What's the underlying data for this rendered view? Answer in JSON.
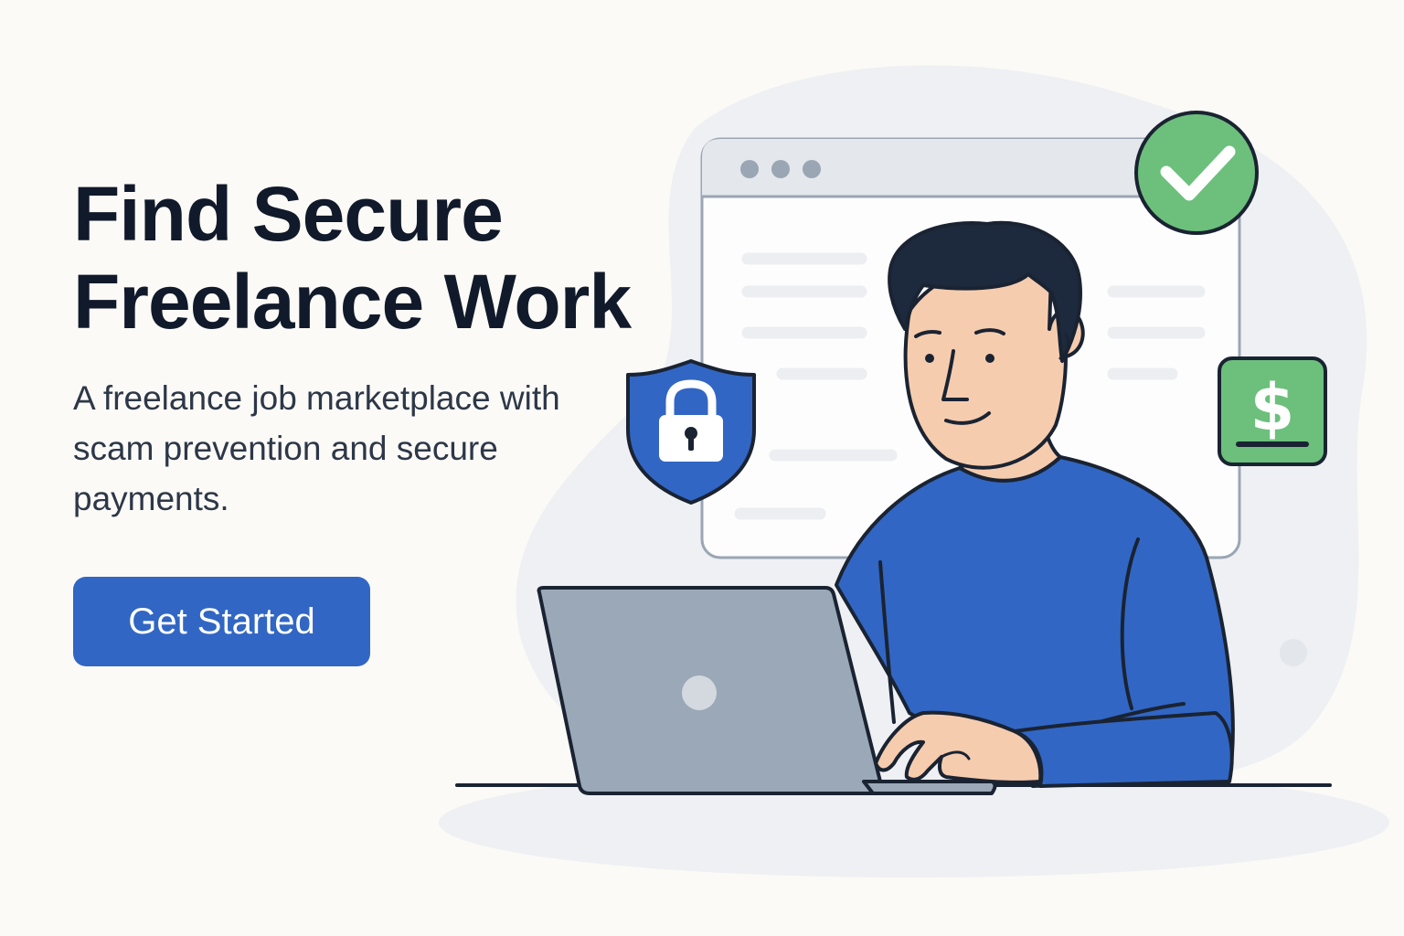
{
  "hero": {
    "title_line1": "Find Secure",
    "title_line2": "Freelance Work",
    "subtitle": "A freelance job marketplace with scam prevention and secure payments.",
    "cta_label": "Get Started"
  },
  "icons": {
    "shield": "shield-lock-icon",
    "check": "check-circle-icon",
    "dollar": "dollar-icon"
  },
  "colors": {
    "primary": "#3166c4",
    "heading": "#111a2b",
    "body_text": "#2d3748",
    "success": "#6cc07c",
    "background": "#fbfaf6",
    "laptop": "#9aa8b8"
  }
}
